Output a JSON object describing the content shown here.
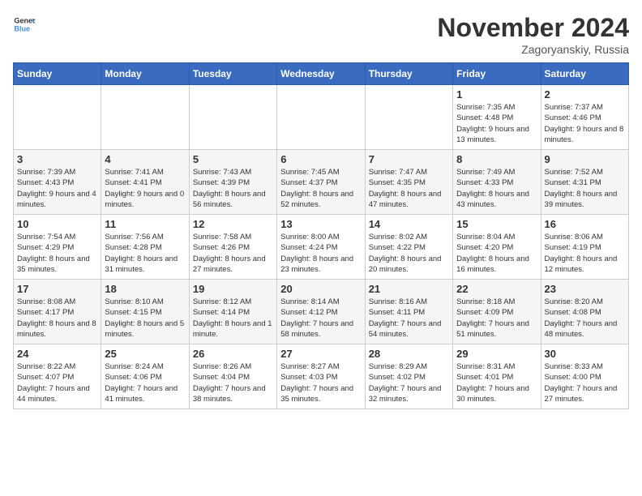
{
  "header": {
    "logo_general": "General",
    "logo_blue": "Blue",
    "month_title": "November 2024",
    "subtitle": "Zagoryanskiy, Russia"
  },
  "days_of_week": [
    "Sunday",
    "Monday",
    "Tuesday",
    "Wednesday",
    "Thursday",
    "Friday",
    "Saturday"
  ],
  "weeks": [
    [
      {
        "day": "",
        "detail": ""
      },
      {
        "day": "",
        "detail": ""
      },
      {
        "day": "",
        "detail": ""
      },
      {
        "day": "",
        "detail": ""
      },
      {
        "day": "",
        "detail": ""
      },
      {
        "day": "1",
        "detail": "Sunrise: 7:35 AM\nSunset: 4:48 PM\nDaylight: 9 hours and 13 minutes."
      },
      {
        "day": "2",
        "detail": "Sunrise: 7:37 AM\nSunset: 4:46 PM\nDaylight: 9 hours and 8 minutes."
      }
    ],
    [
      {
        "day": "3",
        "detail": "Sunrise: 7:39 AM\nSunset: 4:43 PM\nDaylight: 9 hours and 4 minutes."
      },
      {
        "day": "4",
        "detail": "Sunrise: 7:41 AM\nSunset: 4:41 PM\nDaylight: 9 hours and 0 minutes."
      },
      {
        "day": "5",
        "detail": "Sunrise: 7:43 AM\nSunset: 4:39 PM\nDaylight: 8 hours and 56 minutes."
      },
      {
        "day": "6",
        "detail": "Sunrise: 7:45 AM\nSunset: 4:37 PM\nDaylight: 8 hours and 52 minutes."
      },
      {
        "day": "7",
        "detail": "Sunrise: 7:47 AM\nSunset: 4:35 PM\nDaylight: 8 hours and 47 minutes."
      },
      {
        "day": "8",
        "detail": "Sunrise: 7:49 AM\nSunset: 4:33 PM\nDaylight: 8 hours and 43 minutes."
      },
      {
        "day": "9",
        "detail": "Sunrise: 7:52 AM\nSunset: 4:31 PM\nDaylight: 8 hours and 39 minutes."
      }
    ],
    [
      {
        "day": "10",
        "detail": "Sunrise: 7:54 AM\nSunset: 4:29 PM\nDaylight: 8 hours and 35 minutes."
      },
      {
        "day": "11",
        "detail": "Sunrise: 7:56 AM\nSunset: 4:28 PM\nDaylight: 8 hours and 31 minutes."
      },
      {
        "day": "12",
        "detail": "Sunrise: 7:58 AM\nSunset: 4:26 PM\nDaylight: 8 hours and 27 minutes."
      },
      {
        "day": "13",
        "detail": "Sunrise: 8:00 AM\nSunset: 4:24 PM\nDaylight: 8 hours and 23 minutes."
      },
      {
        "day": "14",
        "detail": "Sunrise: 8:02 AM\nSunset: 4:22 PM\nDaylight: 8 hours and 20 minutes."
      },
      {
        "day": "15",
        "detail": "Sunrise: 8:04 AM\nSunset: 4:20 PM\nDaylight: 8 hours and 16 minutes."
      },
      {
        "day": "16",
        "detail": "Sunrise: 8:06 AM\nSunset: 4:19 PM\nDaylight: 8 hours and 12 minutes."
      }
    ],
    [
      {
        "day": "17",
        "detail": "Sunrise: 8:08 AM\nSunset: 4:17 PM\nDaylight: 8 hours and 8 minutes."
      },
      {
        "day": "18",
        "detail": "Sunrise: 8:10 AM\nSunset: 4:15 PM\nDaylight: 8 hours and 5 minutes."
      },
      {
        "day": "19",
        "detail": "Sunrise: 8:12 AM\nSunset: 4:14 PM\nDaylight: 8 hours and 1 minute."
      },
      {
        "day": "20",
        "detail": "Sunrise: 8:14 AM\nSunset: 4:12 PM\nDaylight: 7 hours and 58 minutes."
      },
      {
        "day": "21",
        "detail": "Sunrise: 8:16 AM\nSunset: 4:11 PM\nDaylight: 7 hours and 54 minutes."
      },
      {
        "day": "22",
        "detail": "Sunrise: 8:18 AM\nSunset: 4:09 PM\nDaylight: 7 hours and 51 minutes."
      },
      {
        "day": "23",
        "detail": "Sunrise: 8:20 AM\nSunset: 4:08 PM\nDaylight: 7 hours and 48 minutes."
      }
    ],
    [
      {
        "day": "24",
        "detail": "Sunrise: 8:22 AM\nSunset: 4:07 PM\nDaylight: 7 hours and 44 minutes."
      },
      {
        "day": "25",
        "detail": "Sunrise: 8:24 AM\nSunset: 4:06 PM\nDaylight: 7 hours and 41 minutes."
      },
      {
        "day": "26",
        "detail": "Sunrise: 8:26 AM\nSunset: 4:04 PM\nDaylight: 7 hours and 38 minutes."
      },
      {
        "day": "27",
        "detail": "Sunrise: 8:27 AM\nSunset: 4:03 PM\nDaylight: 7 hours and 35 minutes."
      },
      {
        "day": "28",
        "detail": "Sunrise: 8:29 AM\nSunset: 4:02 PM\nDaylight: 7 hours and 32 minutes."
      },
      {
        "day": "29",
        "detail": "Sunrise: 8:31 AM\nSunset: 4:01 PM\nDaylight: 7 hours and 30 minutes."
      },
      {
        "day": "30",
        "detail": "Sunrise: 8:33 AM\nSunset: 4:00 PM\nDaylight: 7 hours and 27 minutes."
      }
    ]
  ]
}
